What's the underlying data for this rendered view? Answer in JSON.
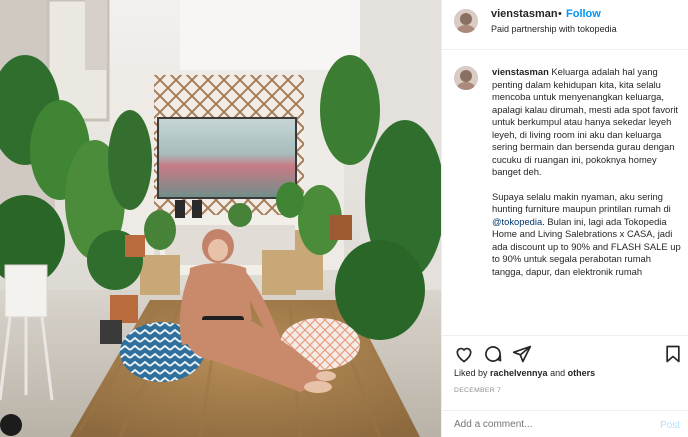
{
  "post": {
    "username": "vienstasman",
    "separator": "•",
    "follow_label": "Follow",
    "partnership": "Paid partnership with tokopedia"
  },
  "caption": {
    "username": "vienstasman",
    "paragraph1": "Keluarga adalah hal yang penting dalam kehidupan kita, kita selalu mencoba untuk menyenangkan keluarga, apalagi kalau dirumah, mesti ada spot favorit untuk berkumpul atau hanya sekedar leyeh leyeh, di living room ini aku dan keluarga sering bermain dan bersenda gurau dengan cucuku di ruangan ini, pokoknya homey banget deh.",
    "paragraph2_before": "Supaya selalu makin nyaman, aku sering hunting furniture maupun printilan rumah di ",
    "mention": "@tokopedia",
    "paragraph2_after": ". Bulan ini, lagi ada Tokopedia Home and Living Salebrations x CASA, jadi ada discount up to 90% and FLASH SALE up to 90% untuk segala perabotan rumah tangga, dapur, dan",
    "paragraph2_cut": "elektronik rumah"
  },
  "icons": {
    "like": "heart-icon",
    "comment": "comment-icon",
    "share": "send-icon",
    "save": "bookmark-icon"
  },
  "likes": {
    "prefix": "Liked by ",
    "user": "rachelvennya",
    "middle": " and ",
    "others": "others"
  },
  "date": "DECEMBER 7",
  "comment": {
    "placeholder": "Add a comment...",
    "post_label": "Post"
  },
  "colors": {
    "follow": "#0095f6",
    "post_disabled": "#b2dffc",
    "muted": "#8e8e8e",
    "dress": "#c98a6c",
    "rug": "#a87c4a"
  }
}
